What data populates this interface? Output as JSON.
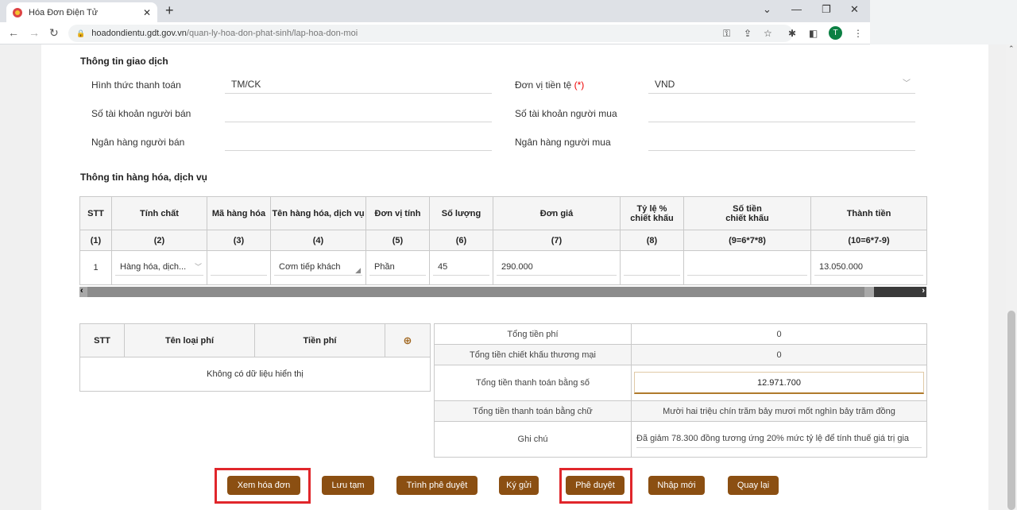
{
  "browser": {
    "tab_title": "Hóa Đơn Điện Tử",
    "url_domain": "hoadondientu.gdt.gov.vn",
    "url_path": "/quan-ly-hoa-don-phat-sinh/lap-hoa-don-moi",
    "avatar_letter": "T"
  },
  "transaction": {
    "section_title": "Thông tin giao dịch",
    "payment_method_label": "Hình thức thanh toán",
    "payment_method_value": "TM/CK",
    "currency_label": "Đơn vị tiền tệ",
    "currency_req": "(*)",
    "currency_value": "VND",
    "seller_account_label": "Số tài khoản người bán",
    "buyer_account_label": "Số tài khoản người mua",
    "seller_bank_label": "Ngân hàng người bán",
    "buyer_bank_label": "Ngân hàng người mua"
  },
  "goods": {
    "section_title": "Thông tin hàng hóa, dịch vụ",
    "headers": {
      "stt": "STT",
      "tinh_chat": "Tính chất",
      "ma_hang": "Mã hàng hóa",
      "ten_hang": "Tên hàng hóa, dịch vụ",
      "dvt": "Đơn vị tính",
      "so_luong": "Số lượng",
      "don_gia": "Đơn giá",
      "ty_le_1": "Tỷ lệ %",
      "ty_le_2": "chiết khấu",
      "so_tien_1": "Số tiền",
      "so_tien_2": "chiết khấu",
      "thanh_tien": "Thành tiền"
    },
    "index_row": [
      "(1)",
      "(2)",
      "(3)",
      "(4)",
      "(5)",
      "(6)",
      "(7)",
      "(8)",
      "(9=6*7*8)",
      "(10=6*7-9)"
    ],
    "row": {
      "stt": "1",
      "tinh_chat": "Hàng hóa, dịch...",
      "ma_hang": "",
      "ten_hang": "Cơm tiếp khách",
      "dvt": "Phần",
      "so_luong": "45",
      "don_gia": "290.000",
      "ty_le": "",
      "so_tien_ck": "",
      "thanh_tien": "13.050.000"
    }
  },
  "fees": {
    "headers": {
      "stt": "STT",
      "name": "Tên loại phí",
      "amount": "Tiền phí"
    },
    "empty_text": "Không có dữ liệu hiển thị"
  },
  "totals": {
    "total_fee_label": "Tổng tiền phí",
    "total_fee_value": "0",
    "trade_discount_label": "Tổng tiền chiết khấu thương mại",
    "trade_discount_value": "0",
    "pay_number_label": "Tổng tiền thanh toán bằng số",
    "pay_number_value": "12.971.700",
    "pay_words_label": "Tổng tiền thanh toán bằng chữ",
    "pay_words_value": "Mười hai triệu chín trăm bảy mươi mốt nghìn bảy trăm đồng",
    "note_label": "Ghi chú",
    "note_value": "Đã giảm  78.300 đồng tương ứng 20% mức tỷ lệ để tính thuế giá trị gia"
  },
  "actions": {
    "view": "Xem hóa đơn",
    "save_draft": "Lưu tạm",
    "submit": "Trình phê duyệt",
    "sign_send": "Ký gửi",
    "approve": "Phê duyệt",
    "new": "Nhập mới",
    "back": "Quay lại"
  },
  "colors": {
    "button": "#8b4f12",
    "highlight": "#e0262b"
  }
}
